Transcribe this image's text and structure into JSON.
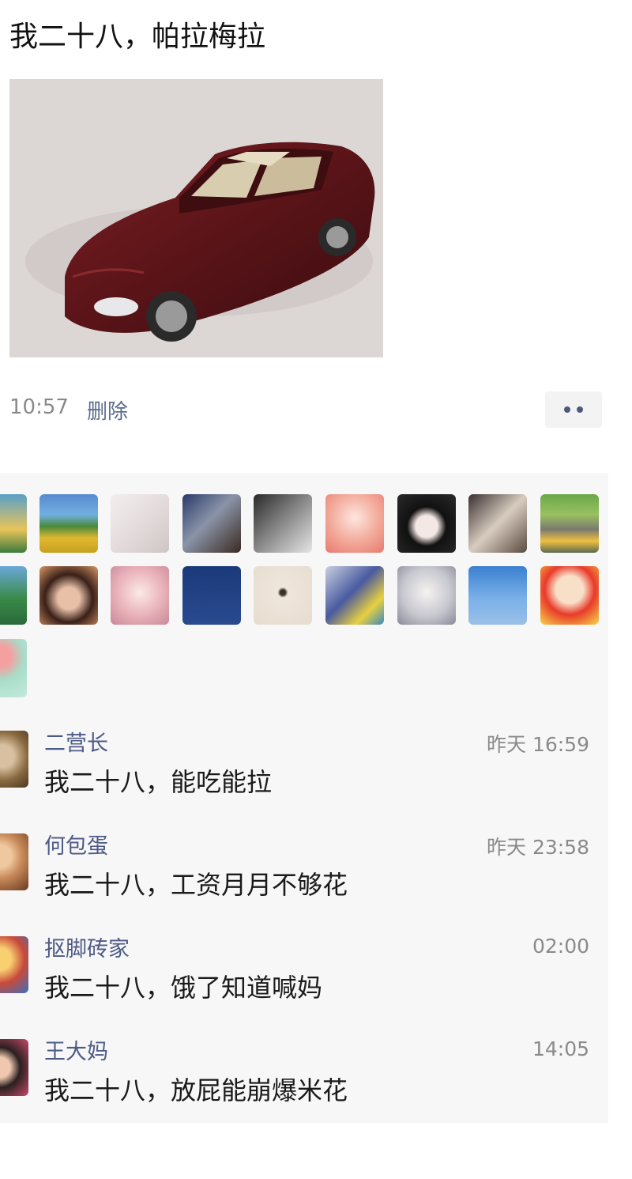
{
  "post": {
    "text": "我二十八，帕拉梅拉",
    "time": "10:57",
    "delete_label": "删除"
  },
  "likes": {
    "avatar_icons": [
      "avatar-cartoon-boy",
      "avatar-landscape-tree",
      "avatar-anime-sketch",
      "avatar-armored-warrior",
      "avatar-anime-dark-boy",
      "avatar-anime-pink-girl",
      "avatar-anime-black-hair",
      "avatar-anime-ink",
      "avatar-road-scene",
      "avatar-landscape-green",
      "avatar-woman-hat",
      "avatar-anime-pink-hair",
      "avatar-night-sky",
      "avatar-beige-figure",
      "avatar-child-photo",
      "avatar-anime-white-hair",
      "avatar-blue-sky",
      "avatar-crayon-shin-chan",
      "avatar-mint-balloon"
    ]
  },
  "comments": [
    {
      "name": "二营长",
      "time": "昨天 16:59",
      "text": "我二十八，能吃能拉"
    },
    {
      "name": "何包蛋",
      "time": "昨天 23:58",
      "text": "我二十八，工资月月不够花"
    },
    {
      "name": "抠脚砖家",
      "time": "02:00",
      "text": "我二十八，饿了知道喊妈"
    },
    {
      "name": "王大妈",
      "time": "14:05",
      "text": "我二十八，放屁能崩爆米花"
    }
  ]
}
